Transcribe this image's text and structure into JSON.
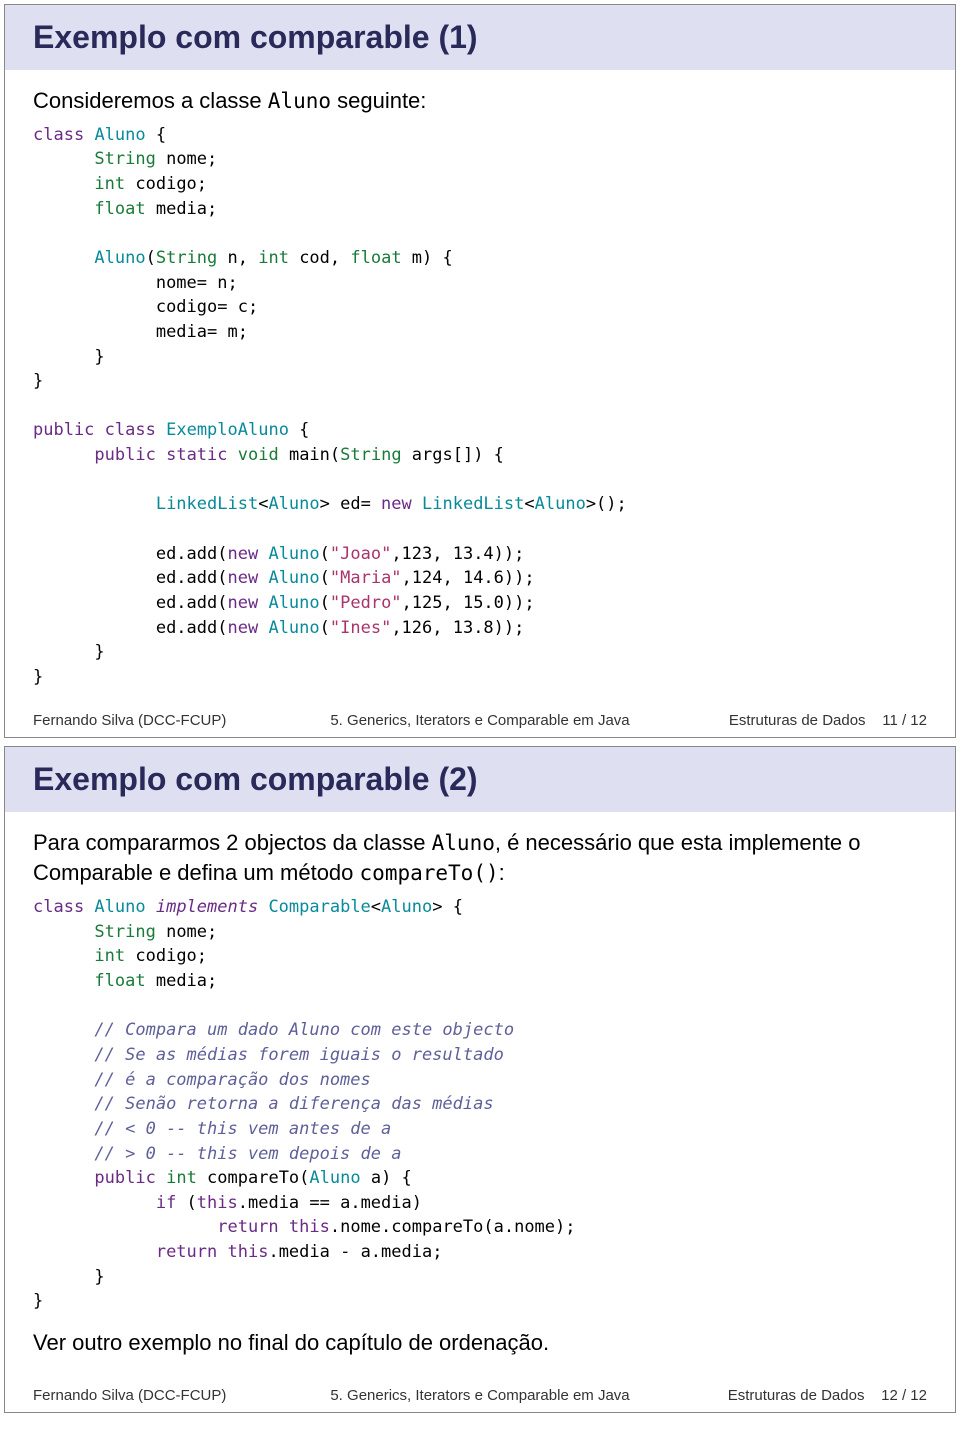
{
  "slides": [
    {
      "title": "Exemplo com comparable (1)",
      "intro_before": "Consideremos a classe ",
      "intro_mono": "Aluno",
      "intro_after": " seguinte:",
      "footer": {
        "left": "Fernando Silva  (DCC-FCUP)",
        "center": "5. Generics, Iterators e Comparable em Java",
        "right_label": "Estruturas de Dados",
        "page": "11 / 12"
      },
      "code": {
        "l1_kw": "class",
        "l1_name": "Aluno",
        "l1_end": " {",
        "l2a": "String",
        "l2b": " nome;",
        "l3a": "int",
        "l3b": " codigo;",
        "l4a": "float",
        "l4b": " media;",
        "l5_name": "Aluno",
        "l5_p1": "(",
        "l5_t1": "String",
        "l5_v1": " n, ",
        "l5_t2": "int",
        "l5_v2": " cod, ",
        "l5_t3": "float",
        "l5_v3": " m",
        "l5_p2": ") {",
        "l6": "nome= n;",
        "l7": "codigo= c;",
        "l8": "media= m;",
        "l9": "}",
        "l10": "}",
        "l11_kw1": "public",
        "l11_kw2": "class",
        "l11_name": "ExemploAluno",
        "l11_end": " {",
        "l12_kw1": "public",
        "l12_kw2": "static",
        "l12_t1": "void",
        "l12_m": " main(",
        "l12_t2": "String",
        "l12_rest": " args[]) {",
        "l13a": "LinkedList",
        "l13b": "<",
        "l13c": "Aluno",
        "l13d": "> ed= ",
        "l13_new": "new",
        "l13e": " ",
        "l13f": "LinkedList",
        "l13g": "<",
        "l13h": "Aluno",
        "l13i": ">();",
        "add1_a": "ed.add(",
        "add1_new": "new",
        "add1_b": " ",
        "add1_c": "Aluno",
        "add1_d": "(",
        "add1_s": "\"Joao\"",
        "add1_e": ",123, 13.4));",
        "add2_a": "ed.add(",
        "add2_new": "new",
        "add2_b": " ",
        "add2_c": "Aluno",
        "add2_d": "(",
        "add2_s": "\"Maria\"",
        "add2_e": ",124, 14.6));",
        "add3_a": "ed.add(",
        "add3_new": "new",
        "add3_b": " ",
        "add3_c": "Aluno",
        "add3_d": "(",
        "add3_s": "\"Pedro\"",
        "add3_e": ",125, 15.0));",
        "add4_a": "ed.add(",
        "add4_new": "new",
        "add4_b": " ",
        "add4_c": "Aluno",
        "add4_d": "(",
        "add4_s": "\"Ines\"",
        "add4_e": ",126, 13.8));",
        "lend1": "}",
        "lend2": "}"
      }
    },
    {
      "title": "Exemplo com comparable (2)",
      "para1_before": "Para compararmos 2 objectos da classe ",
      "para1_mono": "Aluno",
      "para1_after": ", é necessário que esta implemente o Comparable e defina um método ",
      "para1_mono2": "compareTo()",
      "para1_after2": ":",
      "footer": {
        "left": "Fernando Silva  (DCC-FCUP)",
        "center": "5. Generics, Iterators e Comparable em Java",
        "right_label": "Estruturas de Dados",
        "page": "12 / 12"
      },
      "closing": "Ver outro exemplo no final do capítulo de ordenação.",
      "code": {
        "l1_kw": "class",
        "l1_name": " Aluno ",
        "l1_imp": "implements",
        "l1_cmp": " Comparable",
        "l1_b": "<",
        "l1_al": "Aluno",
        "l1_c": "> {",
        "l2a": "String",
        "l2b": " nome;",
        "l3a": "int",
        "l3b": " codigo;",
        "l4a": "float",
        "l4b": " media;",
        "c1": "// Compara um dado Aluno com este objecto",
        "c2": "// Se as médias forem iguais o resultado",
        "c3": "// é a comparação dos nomes",
        "c4": "// Senão retorna a diferença das médias",
        "c5": "// < 0 -- this vem antes de a",
        "c6": "// > 0 -- this vem depois de a",
        "m_kw1": "public",
        "m_t1": "int",
        "m_name": " compareTo(",
        "m_t2": "Aluno",
        "m_rest": " a) {",
        "if_kw": "if",
        "if_a": " (",
        "if_this": "this",
        "if_b": ".media == a.media)",
        "ret1_kw": "return",
        "ret1_a": " ",
        "ret1_this": "this",
        "ret1_b": ".nome.compareTo(a.nome);",
        "ret2_kw": "return",
        "ret2_a": " ",
        "ret2_this": "this",
        "ret2_b": ".media - a.media;",
        "close1": "}",
        "close2": "}"
      }
    }
  ]
}
